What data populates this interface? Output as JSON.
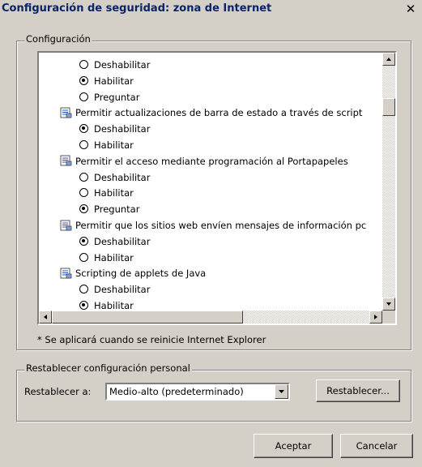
{
  "window": {
    "title": "Configuración de seguridad: zona de Internet",
    "close_glyph": "✕"
  },
  "settings_group": {
    "label": "Configuración"
  },
  "tree_rows": [
    {
      "kind": "option",
      "text": "Deshabilitar",
      "selected": false
    },
    {
      "kind": "option",
      "text": "Habilitar",
      "selected": true
    },
    {
      "kind": "option",
      "text": "Preguntar",
      "selected": false
    },
    {
      "kind": "setting",
      "text": "Permitir actualizaciones de barra de estado a través de script"
    },
    {
      "kind": "option",
      "text": "Deshabilitar",
      "selected": true
    },
    {
      "kind": "option",
      "text": "Habilitar",
      "selected": false
    },
    {
      "kind": "setting",
      "text": "Permitir el acceso mediante programación al Portapapeles"
    },
    {
      "kind": "option",
      "text": "Deshabilitar",
      "selected": false
    },
    {
      "kind": "option",
      "text": "Habilitar",
      "selected": false
    },
    {
      "kind": "option",
      "text": "Preguntar",
      "selected": true
    },
    {
      "kind": "setting",
      "text": "Permitir que los sitios web envíen mensajes de información pc"
    },
    {
      "kind": "option",
      "text": "Deshabilitar",
      "selected": true
    },
    {
      "kind": "option",
      "text": "Habilitar",
      "selected": false
    },
    {
      "kind": "setting",
      "text": "Scripting de applets de Java"
    },
    {
      "kind": "option",
      "text": "Deshabilitar",
      "selected": false
    },
    {
      "kind": "option",
      "text": "Habilitar",
      "selected": true
    }
  ],
  "note": "* Se aplicará cuando se reinicie Internet Explorer",
  "reset_group": {
    "label": "Restablecer configuración personal",
    "reset_to_label": "Restablecer a:",
    "selected_level": "Medio-alto (predeterminado)",
    "reset_button": "Restablecer..."
  },
  "buttons": {
    "ok": "Aceptar",
    "cancel": "Cancelar"
  },
  "icons": {
    "setting": "script-setting-icon",
    "radio": "radio-icon",
    "scroll_up": "arrow-up-icon",
    "scroll_down": "arrow-down-icon",
    "scroll_left": "arrow-left-icon",
    "scroll_right": "arrow-right-icon",
    "dropdown": "chevron-down-icon"
  }
}
